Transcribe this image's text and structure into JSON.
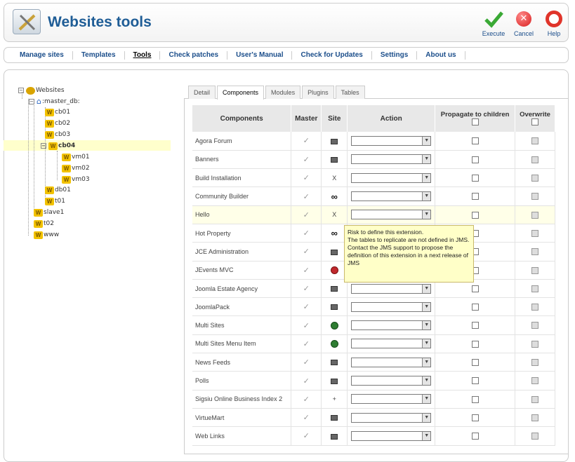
{
  "header": {
    "title": "Websites tools",
    "buttons": [
      {
        "label": "Execute",
        "icon": "checkmark-icon"
      },
      {
        "label": "Cancel",
        "icon": "cancel-icon"
      },
      {
        "label": "Help",
        "icon": "lifebuoy-icon"
      }
    ]
  },
  "menu": [
    "Manage sites",
    "Templates",
    "Tools",
    "Check patches",
    "User's Manual",
    "Check for Updates",
    "Settings",
    "About us"
  ],
  "menu_active": "Tools",
  "tree": {
    "root": "Websites",
    "master": ":master_db:",
    "nodes": [
      "cb01",
      "cb02",
      "cb03",
      "cb04",
      "vm01",
      "vm02",
      "vm03",
      "db01",
      "t01",
      "slave1",
      "t02",
      "www"
    ],
    "selected": "cb04"
  },
  "tabs": [
    "Detail",
    "Components",
    "Modules",
    "Plugins",
    "Tables"
  ],
  "active_tab": "Components",
  "table": {
    "headers": {
      "components": "Components",
      "master": "Master",
      "site": "Site",
      "action": "Action",
      "propagate": "Propagate to children",
      "overwrite": "Overwrite"
    },
    "rows": [
      {
        "name": "Agora Forum",
        "site": "table"
      },
      {
        "name": "Banners",
        "site": "table"
      },
      {
        "name": "Build Installation",
        "site": "x"
      },
      {
        "name": "Community Builder",
        "site": "link"
      },
      {
        "name": "Hello",
        "site": "x"
      },
      {
        "name": "Hot Property",
        "site": "link"
      },
      {
        "name": "JCE Administration",
        "site": "table"
      },
      {
        "name": "JEvents MVC",
        "site": "red"
      },
      {
        "name": "Joomla Estate Agency",
        "site": "table"
      },
      {
        "name": "JoomlaPack",
        "site": "table"
      },
      {
        "name": "Multi Sites",
        "site": "green"
      },
      {
        "name": "Multi Sites Menu Item",
        "site": "green"
      },
      {
        "name": "News Feeds",
        "site": "table"
      },
      {
        "name": "Polls",
        "site": "table"
      },
      {
        "name": "Sigsiu Online Business Index 2",
        "site": "plus"
      },
      {
        "name": "VirtueMart",
        "site": "table"
      },
      {
        "name": "Web Links",
        "site": "table"
      }
    ]
  },
  "tooltip": {
    "line1": "Risk to define this extension.",
    "line2": "The tables to replicate are not defined in JMS.",
    "line3": "Contact the JMS support to propose the definition of this extension in a next release of JMS"
  }
}
